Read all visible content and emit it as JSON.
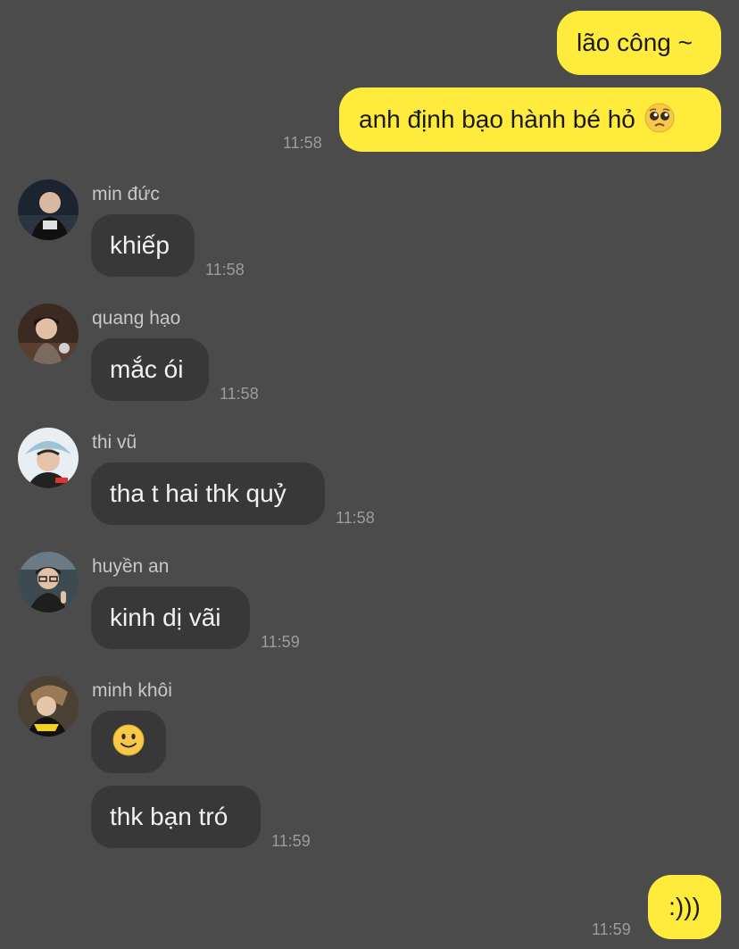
{
  "outgoing": [
    {
      "text": "lão công ~"
    },
    {
      "text": "anh định bạo hành bé hỏ",
      "emoji": "pleading-face-icon",
      "time": "11:58"
    }
  ],
  "incoming": [
    {
      "sender": "min đức",
      "text": "khiếp",
      "time": "11:58"
    },
    {
      "sender": "quang hạo",
      "text": "mắc ói",
      "time": "11:58"
    },
    {
      "sender": "thi vũ",
      "text": "tha t hai thk quỷ",
      "time": "11:58"
    },
    {
      "sender": "huyền an",
      "text": "kinh dị vãi",
      "time": "11:59"
    },
    {
      "sender": "minh khôi",
      "emoji": "slightly-smiling-face-icon",
      "text": "thk bạn tró",
      "time": "11:59"
    }
  ],
  "final_outgoing": {
    "text": ":)))",
    "time": "11:59"
  },
  "colors": {
    "background": "#4b4b4b",
    "outgoing_bubble": "#ffeb3b",
    "incoming_bubble": "#383838",
    "timestamp": "#9c9c9c"
  }
}
